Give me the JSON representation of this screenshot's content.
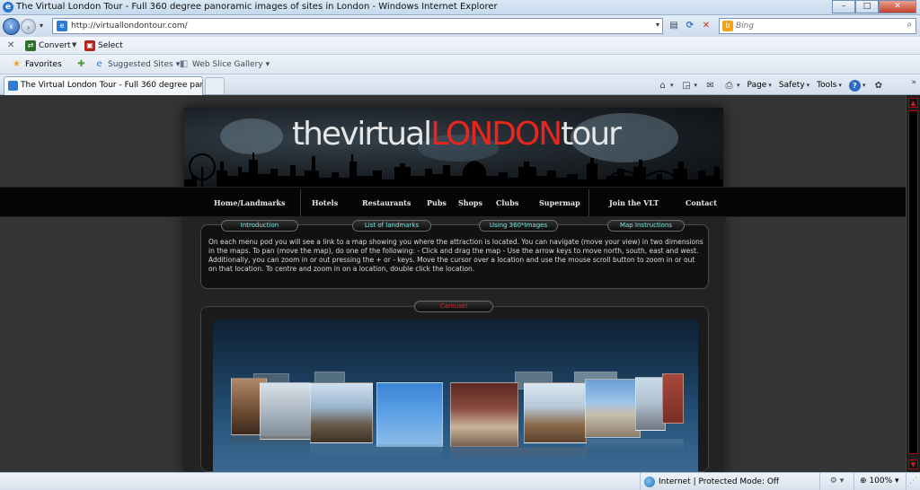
{
  "window": {
    "title": "The Virtual London Tour - Full 360 degree panoramic images of sites in London - Windows Internet Explorer",
    "controls": {
      "minimize": "–",
      "maximize": "□",
      "close": "✕"
    }
  },
  "address_bar": {
    "url": "http://virtuallondontour.com/",
    "search_placeholder": "Bing"
  },
  "command_bar": {
    "convert": "Convert",
    "select": "Select"
  },
  "favorites_bar": {
    "favorites": "Favorites",
    "suggested_sites": "Suggested Sites",
    "web_slice_gallery": "Web Slice Gallery"
  },
  "tab": {
    "title": "The Virtual London Tour - Full 360 degree panora..."
  },
  "toolbar": {
    "page": "Page",
    "safety": "Safety",
    "tools": "Tools"
  },
  "site": {
    "logo": {
      "part1": "thevirtual",
      "part2": "LONDON",
      "part3": "tour"
    },
    "menu": [
      "Home/Landmarks",
      "Hotels",
      "Restaurants",
      "Pubs",
      "Shops",
      "Clubs",
      "Supermap",
      "Join the VLT",
      "Contact"
    ],
    "panel_tabs": [
      "Introduction",
      "List of landmarks",
      "Using 360*Images",
      "Map Instructions"
    ],
    "panel_text": "On each menu pod you will see a link to a map showing you where the attraction is located. You can navigate (move your view) in two dimensions in the maps. To pan (move the map), do one of the following: - Click and drag the map - Use the arrow keys to move north, south, east and west. Additionally, you can zoom in or out pressing the + or - keys. Move the cursor over a location and use the mouse scroll button to zoom in or out on that location. To centre and zoom in on a location, double click the location.",
    "carousel_label": "Carousel"
  },
  "status_bar": {
    "zone": "Internet | Protected Mode: Off",
    "zoom": "100%"
  },
  "colors": {
    "accent_red": "#e8261d",
    "panel_tab_text": "#7fe7e3"
  }
}
